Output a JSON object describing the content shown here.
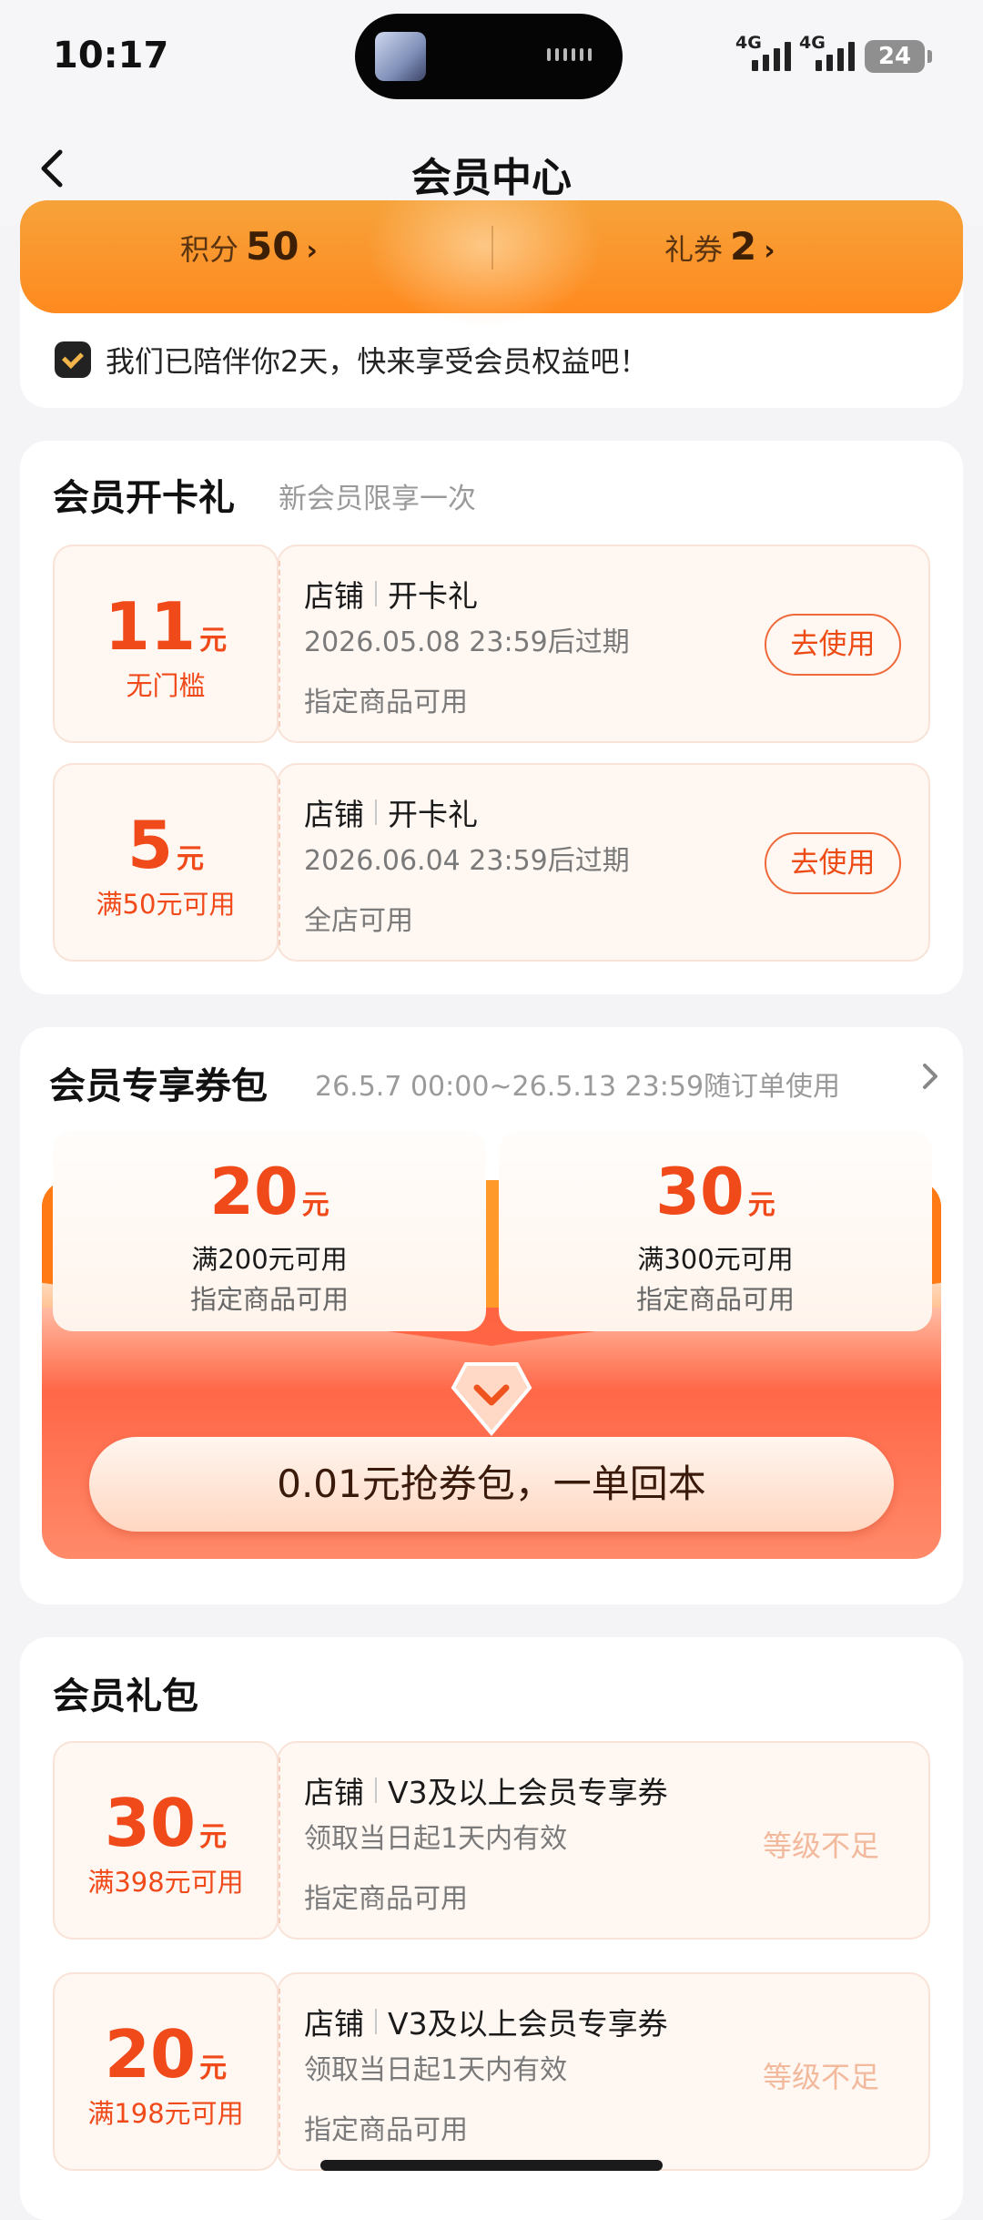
{
  "status_bar": {
    "time": "10:17",
    "signal1": "4G",
    "signal2": "4G",
    "battery": "24"
  },
  "header": {
    "title": "会员中心"
  },
  "summary": {
    "points_label": "积分",
    "points_value": "50",
    "coupons_label": "礼券",
    "coupons_value": "2",
    "hint": "我们已陪伴你2天，快来享受会员权益吧！"
  },
  "open_card": {
    "title": "会员开卡礼",
    "subtitle": "新会员限享一次",
    "coupons": [
      {
        "amount": "11",
        "unit": "元",
        "condition": "无门槛",
        "source": "店铺",
        "name": "开卡礼",
        "expire": "2026.05.08 23:59后过期",
        "scope": "指定商品可用",
        "action": "去使用"
      },
      {
        "amount": "5",
        "unit": "元",
        "condition": "满50元可用",
        "source": "店铺",
        "name": "开卡礼",
        "expire": "2026.06.04 23:59后过期",
        "scope": "全店可用",
        "action": "去使用"
      }
    ]
  },
  "package": {
    "title": "会员专享券包",
    "period": "26.5.7 00:00~26.5.13 23:59随订单使用",
    "items": [
      {
        "amount": "20",
        "unit": "元",
        "condition": "满200元可用",
        "scope": "指定商品可用"
      },
      {
        "amount": "30",
        "unit": "元",
        "condition": "满300元可用",
        "scope": "指定商品可用"
      }
    ],
    "cta": "0.01元抢券包，一单回本"
  },
  "gift": {
    "title": "会员礼包",
    "coupons": [
      {
        "amount": "30",
        "unit": "元",
        "condition": "满398元可用",
        "source": "店铺",
        "name": "V3及以上会员专享券",
        "expire": "领取当日起1天内有效",
        "scope": "指定商品可用",
        "status": "等级不足"
      },
      {
        "amount": "20",
        "unit": "元",
        "condition": "满198元可用",
        "source": "店铺",
        "name": "V3及以上会员专享券",
        "expire": "领取当日起1天内有效",
        "scope": "指定商品可用",
        "status": "等级不足"
      }
    ]
  },
  "colors": {
    "accent": "#f04a1a",
    "orange": "#ff8a1f",
    "red": "#ff5a36"
  }
}
